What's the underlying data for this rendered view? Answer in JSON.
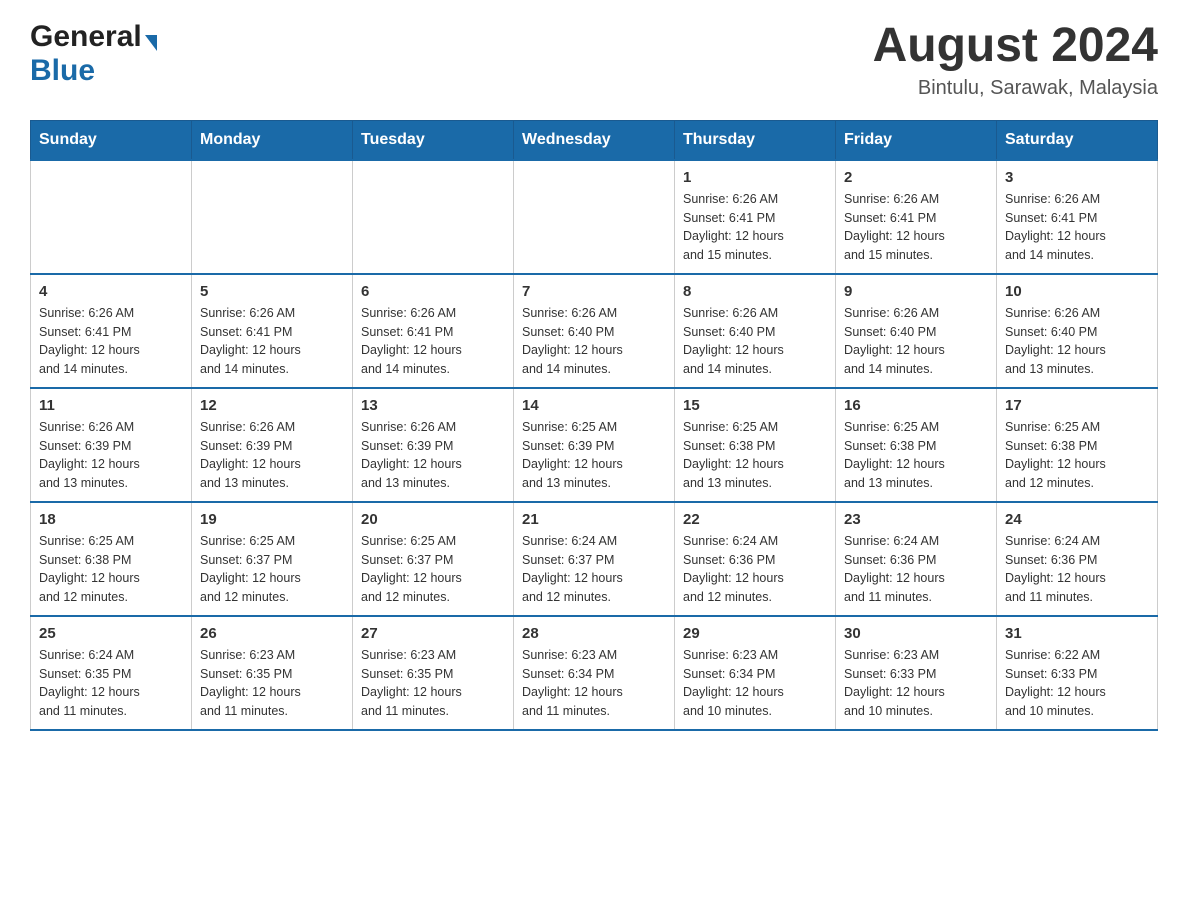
{
  "header": {
    "logo": {
      "general_text": "General",
      "blue_text": "Blue"
    },
    "title": "August 2024",
    "location": "Bintulu, Sarawak, Malaysia"
  },
  "weekdays": [
    "Sunday",
    "Monday",
    "Tuesday",
    "Wednesday",
    "Thursday",
    "Friday",
    "Saturday"
  ],
  "weeks": [
    {
      "days": [
        {
          "num": "",
          "info": ""
        },
        {
          "num": "",
          "info": ""
        },
        {
          "num": "",
          "info": ""
        },
        {
          "num": "",
          "info": ""
        },
        {
          "num": "1",
          "info": "Sunrise: 6:26 AM\nSunset: 6:41 PM\nDaylight: 12 hours\nand 15 minutes."
        },
        {
          "num": "2",
          "info": "Sunrise: 6:26 AM\nSunset: 6:41 PM\nDaylight: 12 hours\nand 15 minutes."
        },
        {
          "num": "3",
          "info": "Sunrise: 6:26 AM\nSunset: 6:41 PM\nDaylight: 12 hours\nand 14 minutes."
        }
      ]
    },
    {
      "days": [
        {
          "num": "4",
          "info": "Sunrise: 6:26 AM\nSunset: 6:41 PM\nDaylight: 12 hours\nand 14 minutes."
        },
        {
          "num": "5",
          "info": "Sunrise: 6:26 AM\nSunset: 6:41 PM\nDaylight: 12 hours\nand 14 minutes."
        },
        {
          "num": "6",
          "info": "Sunrise: 6:26 AM\nSunset: 6:41 PM\nDaylight: 12 hours\nand 14 minutes."
        },
        {
          "num": "7",
          "info": "Sunrise: 6:26 AM\nSunset: 6:40 PM\nDaylight: 12 hours\nand 14 minutes."
        },
        {
          "num": "8",
          "info": "Sunrise: 6:26 AM\nSunset: 6:40 PM\nDaylight: 12 hours\nand 14 minutes."
        },
        {
          "num": "9",
          "info": "Sunrise: 6:26 AM\nSunset: 6:40 PM\nDaylight: 12 hours\nand 14 minutes."
        },
        {
          "num": "10",
          "info": "Sunrise: 6:26 AM\nSunset: 6:40 PM\nDaylight: 12 hours\nand 13 minutes."
        }
      ]
    },
    {
      "days": [
        {
          "num": "11",
          "info": "Sunrise: 6:26 AM\nSunset: 6:39 PM\nDaylight: 12 hours\nand 13 minutes."
        },
        {
          "num": "12",
          "info": "Sunrise: 6:26 AM\nSunset: 6:39 PM\nDaylight: 12 hours\nand 13 minutes."
        },
        {
          "num": "13",
          "info": "Sunrise: 6:26 AM\nSunset: 6:39 PM\nDaylight: 12 hours\nand 13 minutes."
        },
        {
          "num": "14",
          "info": "Sunrise: 6:25 AM\nSunset: 6:39 PM\nDaylight: 12 hours\nand 13 minutes."
        },
        {
          "num": "15",
          "info": "Sunrise: 6:25 AM\nSunset: 6:38 PM\nDaylight: 12 hours\nand 13 minutes."
        },
        {
          "num": "16",
          "info": "Sunrise: 6:25 AM\nSunset: 6:38 PM\nDaylight: 12 hours\nand 13 minutes."
        },
        {
          "num": "17",
          "info": "Sunrise: 6:25 AM\nSunset: 6:38 PM\nDaylight: 12 hours\nand 12 minutes."
        }
      ]
    },
    {
      "days": [
        {
          "num": "18",
          "info": "Sunrise: 6:25 AM\nSunset: 6:38 PM\nDaylight: 12 hours\nand 12 minutes."
        },
        {
          "num": "19",
          "info": "Sunrise: 6:25 AM\nSunset: 6:37 PM\nDaylight: 12 hours\nand 12 minutes."
        },
        {
          "num": "20",
          "info": "Sunrise: 6:25 AM\nSunset: 6:37 PM\nDaylight: 12 hours\nand 12 minutes."
        },
        {
          "num": "21",
          "info": "Sunrise: 6:24 AM\nSunset: 6:37 PM\nDaylight: 12 hours\nand 12 minutes."
        },
        {
          "num": "22",
          "info": "Sunrise: 6:24 AM\nSunset: 6:36 PM\nDaylight: 12 hours\nand 12 minutes."
        },
        {
          "num": "23",
          "info": "Sunrise: 6:24 AM\nSunset: 6:36 PM\nDaylight: 12 hours\nand 11 minutes."
        },
        {
          "num": "24",
          "info": "Sunrise: 6:24 AM\nSunset: 6:36 PM\nDaylight: 12 hours\nand 11 minutes."
        }
      ]
    },
    {
      "days": [
        {
          "num": "25",
          "info": "Sunrise: 6:24 AM\nSunset: 6:35 PM\nDaylight: 12 hours\nand 11 minutes."
        },
        {
          "num": "26",
          "info": "Sunrise: 6:23 AM\nSunset: 6:35 PM\nDaylight: 12 hours\nand 11 minutes."
        },
        {
          "num": "27",
          "info": "Sunrise: 6:23 AM\nSunset: 6:35 PM\nDaylight: 12 hours\nand 11 minutes."
        },
        {
          "num": "28",
          "info": "Sunrise: 6:23 AM\nSunset: 6:34 PM\nDaylight: 12 hours\nand 11 minutes."
        },
        {
          "num": "29",
          "info": "Sunrise: 6:23 AM\nSunset: 6:34 PM\nDaylight: 12 hours\nand 10 minutes."
        },
        {
          "num": "30",
          "info": "Sunrise: 6:23 AM\nSunset: 6:33 PM\nDaylight: 12 hours\nand 10 minutes."
        },
        {
          "num": "31",
          "info": "Sunrise: 6:22 AM\nSunset: 6:33 PM\nDaylight: 12 hours\nand 10 minutes."
        }
      ]
    }
  ]
}
